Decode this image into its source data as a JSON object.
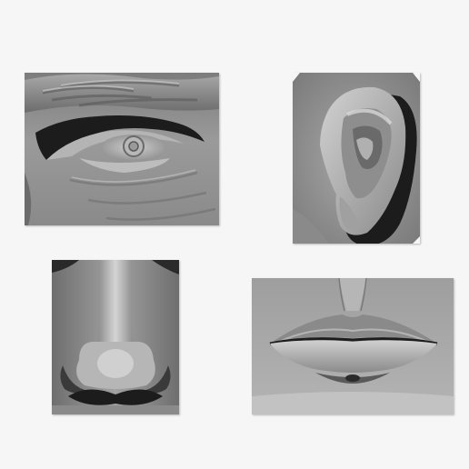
{
  "scene": {
    "background": "#f6f6f6",
    "sculpt_base": "#8f8f8f",
    "sculpt_highlight": "#d8d8d8",
    "sculpt_shadow": "#1c1c1c"
  },
  "tiles": [
    {
      "subject": "eye"
    },
    {
      "subject": "ear"
    },
    {
      "subject": "nose"
    },
    {
      "subject": "mouth"
    }
  ]
}
